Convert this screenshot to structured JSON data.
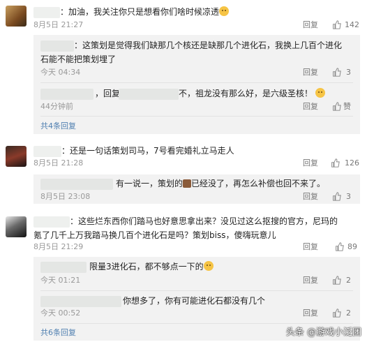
{
  "comments": [
    {
      "text": "：加油，我关注你只是想看你们啥时候凉透",
      "time": "8月5日 21:27",
      "reply_label": "回复",
      "likes": "142",
      "replies": [
        {
          "text": "：这策划是觉得我们缺那几个核还是缺那几个进化石，我换上几百个进化",
          "text2": "石能不能把策划埋了",
          "time": "今天 04:34",
          "reply_label": "回复",
          "likes": "3"
        },
        {
          "text_a": "，回复",
          "text_b": "不，祖龙没有那么好，是六级圣核！",
          "time": "44分钟前",
          "reply_label": "回复",
          "likes": "赞"
        }
      ],
      "total_replies": "共4条回复"
    },
    {
      "text": "：还是一句话策划司马，7号看完婚礼立马走人",
      "time": "8月5日 21:28",
      "reply_label": "回复",
      "likes": "126",
      "replies": [
        {
          "text_a": "有一说一，策划的",
          "text_b": "已经没了，再怎么补偿也回不来了。",
          "time": "8月5日 23:08",
          "reply_label": "回复",
          "likes": "3"
        }
      ]
    },
    {
      "text": "：这些烂东西你们踏马也好意思拿出来？没见过这么抠搜的官方，尼玛的",
      "text2": "氪了几千上万我踏马换几百个进化石是吗？策划biss，傻嗨玩意儿",
      "time": "8月5日 21:29",
      "reply_label": "回复",
      "likes": "89",
      "replies": [
        {
          "text": "限量3进化石，都不够点一下的",
          "time": "今天 01:21",
          "reply_label": "回复",
          "likes": "2"
        },
        {
          "text": "你想多了，你有可能进化石都没有几个",
          "time": "今天 00:52",
          "reply_label": "回复",
          "likes": "2"
        }
      ],
      "total_replies": "共6条回复"
    }
  ],
  "watermark": "头条 @游戏小泛团",
  "colors": {
    "reply_bg": "#f2f2f2",
    "link": "#4f7fb0",
    "meta": "#999999"
  }
}
